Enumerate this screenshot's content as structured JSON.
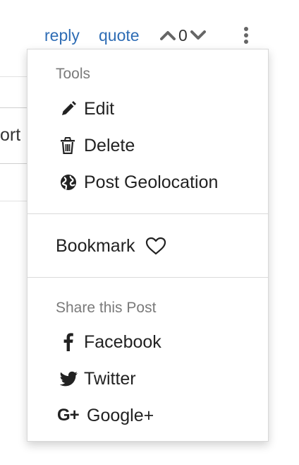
{
  "toolbar": {
    "reply_label": "reply",
    "quote_label": "quote",
    "vote_count": "0"
  },
  "background": {
    "partial_text": "ort"
  },
  "menu": {
    "tools_header": "Tools",
    "tools": [
      {
        "label": "Edit",
        "icon": "pencil-icon"
      },
      {
        "label": "Delete",
        "icon": "trash-icon"
      },
      {
        "label": "Post Geolocation",
        "icon": "globe-icon"
      }
    ],
    "bookmark": {
      "label": "Bookmark",
      "icon": "heart-icon"
    },
    "share_header": "Share this Post",
    "share": [
      {
        "label": "Facebook",
        "icon": "facebook-icon"
      },
      {
        "label": "Twitter",
        "icon": "twitter-icon"
      },
      {
        "label": "Google+",
        "icon": "google-plus-icon",
        "icon_text": "G+"
      }
    ]
  },
  "colors": {
    "link": "#2f6db5",
    "text": "#222222",
    "muted": "#7a7a7a"
  }
}
